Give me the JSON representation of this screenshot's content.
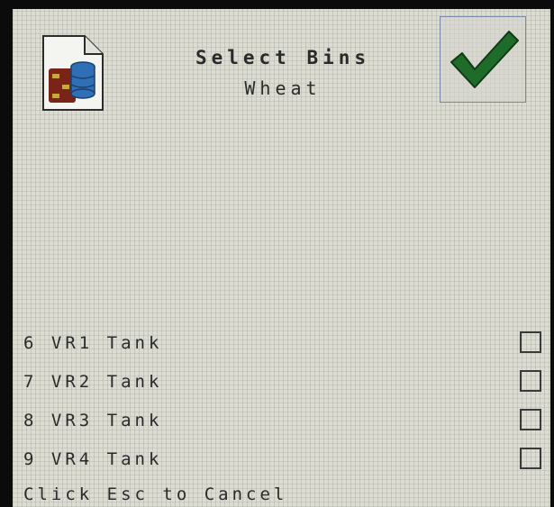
{
  "header": {
    "title": "Select Bins",
    "subtitle": "Wheat"
  },
  "icons": {
    "file_button": "file-bins-icon",
    "ok_button": "checkmark-icon"
  },
  "bins": [
    {
      "label": "6 VR1 Tank",
      "checked": false
    },
    {
      "label": "7 VR2 Tank",
      "checked": false
    },
    {
      "label": "8 VR3 Tank",
      "checked": false
    },
    {
      "label": "9 VR4 Tank",
      "checked": false
    }
  ],
  "footer": {
    "hint": "Click Esc to Cancel"
  },
  "colors": {
    "screen_bg": "#dcdcd2",
    "checkmark": "#1f6b2a",
    "text": "#2a2a2a"
  }
}
